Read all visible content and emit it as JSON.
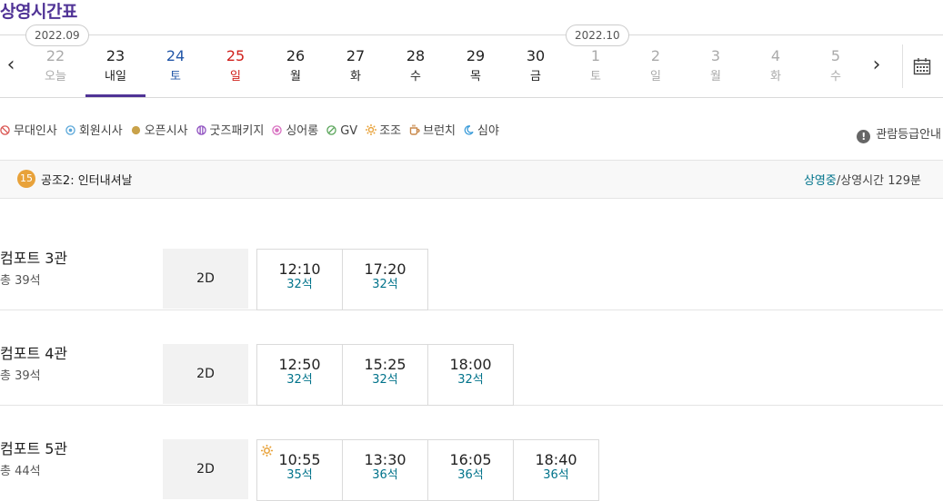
{
  "page_title": "상영시간표",
  "months": [
    "2022.09",
    "2022.10"
  ],
  "dates": [
    {
      "day": "22",
      "dow": "오늘",
      "color": "#aaaaaa"
    },
    {
      "day": "23",
      "dow": "내일",
      "color": "#222222"
    },
    {
      "day": "24",
      "dow": "토",
      "color": "#2357a8"
    },
    {
      "day": "25",
      "dow": "일",
      "color": "#d0211c"
    },
    {
      "day": "26",
      "dow": "월",
      "color": "#222222"
    },
    {
      "day": "27",
      "dow": "화",
      "color": "#222222"
    },
    {
      "day": "28",
      "dow": "수",
      "color": "#222222"
    },
    {
      "day": "29",
      "dow": "목",
      "color": "#222222"
    },
    {
      "day": "30",
      "dow": "금",
      "color": "#222222"
    },
    {
      "day": "1",
      "dow": "토",
      "color": "#aaaaaa"
    },
    {
      "day": "2",
      "dow": "일",
      "color": "#aaaaaa"
    },
    {
      "day": "3",
      "dow": "월",
      "color": "#aaaaaa"
    },
    {
      "day": "4",
      "dow": "화",
      "color": "#aaaaaa"
    },
    {
      "day": "5",
      "dow": "수",
      "color": "#aaaaaa"
    }
  ],
  "selected_date_index": 1,
  "arrows": {
    "prev": "‹",
    "next": "›"
  },
  "legend": [
    {
      "label": "무대인사",
      "icon": "stage-greeting-icon",
      "color": "#d9534f"
    },
    {
      "label": "회원시사",
      "icon": "member-preview-icon",
      "color": "#5aa7d9"
    },
    {
      "label": "오픈시사",
      "icon": "open-preview-icon",
      "color": "#c9a24a"
    },
    {
      "label": "굿즈패키지",
      "icon": "goods-package-icon",
      "color": "#8e4fbf"
    },
    {
      "label": "싱어롱",
      "icon": "sing-along-icon",
      "color": "#d86fc0"
    },
    {
      "label": "GV",
      "icon": "gv-icon",
      "color": "#5aa55a"
    },
    {
      "label": "조조",
      "icon": "morning-sun-icon",
      "color": "#e8a23a"
    },
    {
      "label": "브런치",
      "icon": "brunch-cup-icon",
      "color": "#c9884a"
    },
    {
      "label": "심야",
      "icon": "late-night-moon-icon",
      "color": "#3a9bd9"
    }
  ],
  "rating_guide": "관람등급안내",
  "movie": {
    "age": "15",
    "title": "공조2: 인터내셔날",
    "status": "상영중",
    "runtime": "/상영시간 129분"
  },
  "halls": [
    {
      "name": "컴포트 3관",
      "seats": "총 39석",
      "format": "2D",
      "times": [
        {
          "time": "12:10",
          "seats": "32석"
        },
        {
          "time": "17:20",
          "seats": "32석"
        }
      ]
    },
    {
      "name": "컴포트 4관",
      "seats": "총 39석",
      "format": "2D",
      "times": [
        {
          "time": "12:50",
          "seats": "32석"
        },
        {
          "time": "15:25",
          "seats": "32석"
        },
        {
          "time": "18:00",
          "seats": "32석"
        }
      ]
    },
    {
      "name": "컴포트 5관",
      "seats": "총 44석",
      "format": "2D",
      "times": [
        {
          "time": "10:55",
          "seats": "35석",
          "morning": true
        },
        {
          "time": "13:30",
          "seats": "36석"
        },
        {
          "time": "16:05",
          "seats": "36석"
        },
        {
          "time": "18:40",
          "seats": "36석"
        }
      ]
    }
  ]
}
